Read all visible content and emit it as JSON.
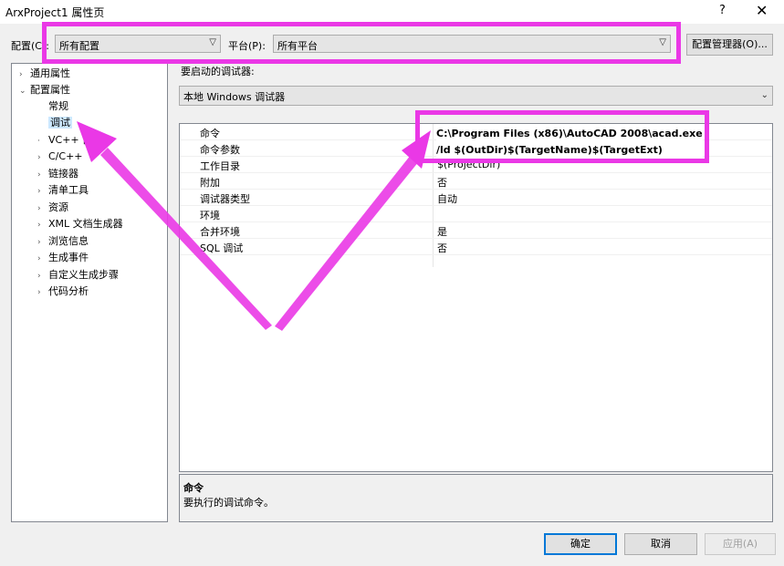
{
  "window": {
    "title": "ArxProject1 属性页",
    "help": "?",
    "close": "✕"
  },
  "config": {
    "label": "配置(C):",
    "value": "所有配置"
  },
  "platform": {
    "label": "平台(P):",
    "value": "所有平台"
  },
  "config_manager": "配置管理器(O)...",
  "tree": {
    "items": [
      {
        "label": "通用属性",
        "expander": "›"
      },
      {
        "label": "配置属性",
        "expander": "⌄"
      },
      {
        "label": "常规",
        "expander": ""
      },
      {
        "label": "调试",
        "expander": ""
      },
      {
        "label": "VC++ 目录",
        "expander": "·"
      },
      {
        "label": "C/C++",
        "expander": "›"
      },
      {
        "label": "链接器",
        "expander": "›"
      },
      {
        "label": "清单工具",
        "expander": "›"
      },
      {
        "label": "资源",
        "expander": "›"
      },
      {
        "label": "XML 文档生成器",
        "expander": "›"
      },
      {
        "label": "浏览信息",
        "expander": "›"
      },
      {
        "label": "生成事件",
        "expander": "›"
      },
      {
        "label": "自定义生成步骤",
        "expander": "›"
      },
      {
        "label": "代码分析",
        "expander": "›"
      }
    ]
  },
  "debugger": {
    "label": "要启动的调试器:",
    "value": "本地 Windows 调试器"
  },
  "props": [
    {
      "name": "命令",
      "value": ""
    },
    {
      "name": "命令参数",
      "value": ""
    },
    {
      "name": "工作目录",
      "value": "$(ProjectDir)"
    },
    {
      "name": "附加",
      "value": "否"
    },
    {
      "name": "调试器类型",
      "value": "自动"
    },
    {
      "name": "环境",
      "value": ""
    },
    {
      "name": "合并环境",
      "value": "是"
    },
    {
      "name": "SQL 调试",
      "value": "否"
    }
  ],
  "command_value": {
    "line1": "C:\\Program Files (x86)\\AutoCAD 2008\\acad.exe",
    "line2": "/ld $(OutDir)$(TargetName)$(TargetExt)"
  },
  "description": {
    "title": "命令",
    "text": "要执行的调试命令。"
  },
  "buttons": {
    "ok": "确定",
    "cancel": "取消",
    "apply": "应用(A)"
  },
  "annotation_color": "#ea38e6"
}
